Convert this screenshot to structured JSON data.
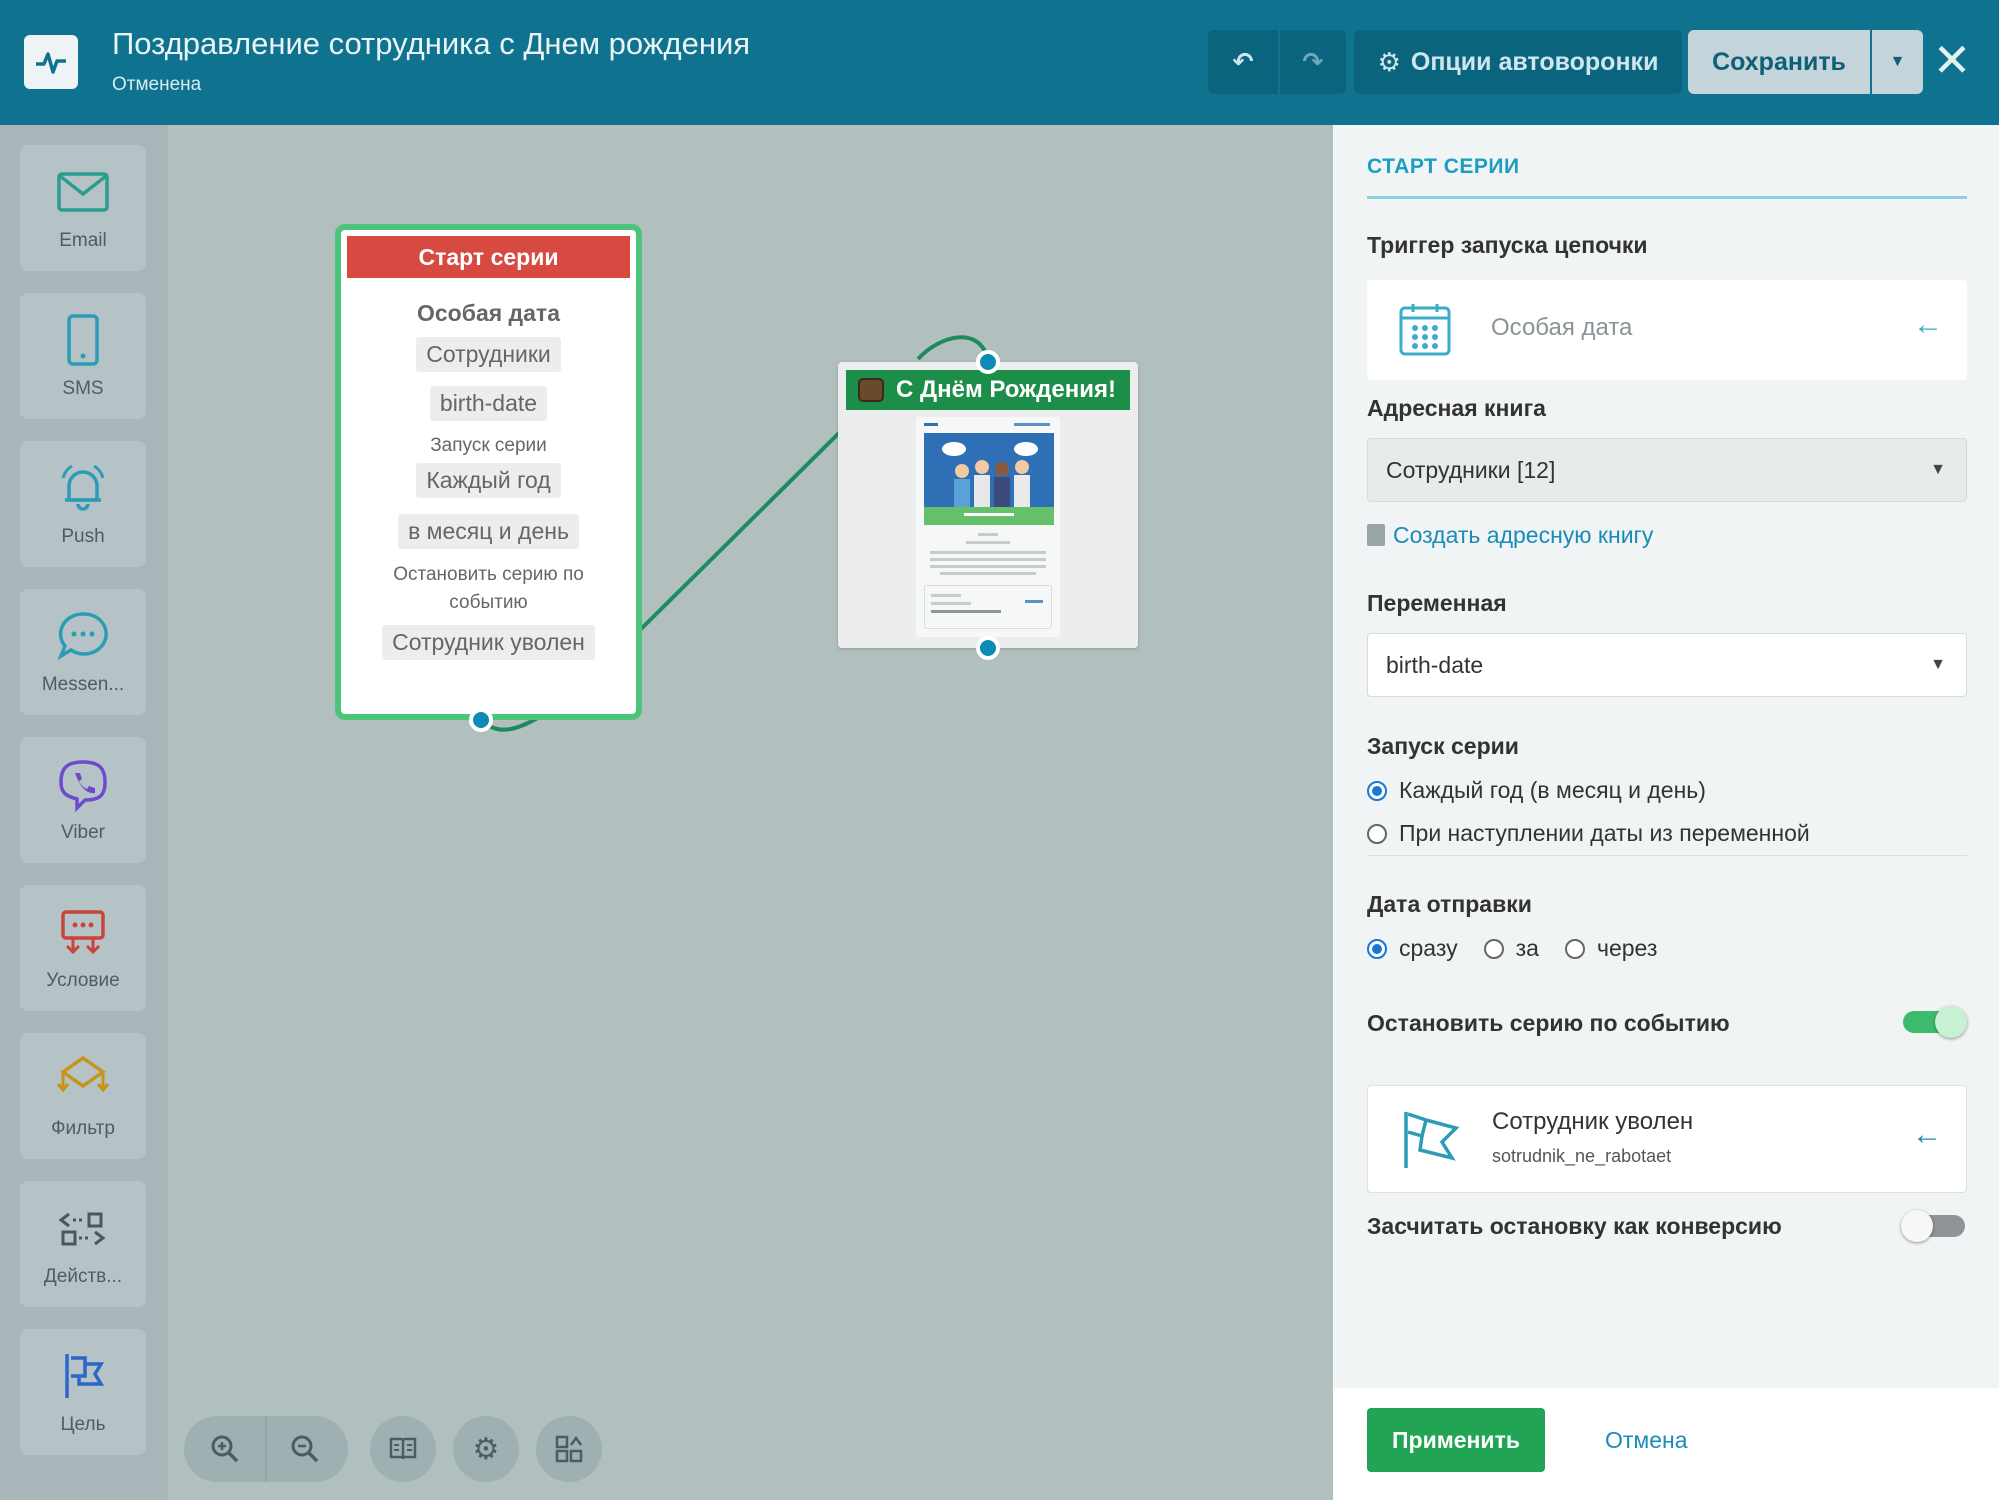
{
  "header": {
    "title": "Поздравление сотрудника с Днем рождения",
    "status": "Отменена",
    "options_label": "Опции автоворонки",
    "save_label": "Сохранить"
  },
  "toolbar": {
    "items": [
      {
        "label": "Email",
        "icon": "envelope-icon",
        "color": "#2a9d8f"
      },
      {
        "label": "SMS",
        "icon": "phone-icon",
        "color": "#2a9db5"
      },
      {
        "label": "Push",
        "icon": "bell-icon",
        "color": "#2a9db5"
      },
      {
        "label": "Messen...",
        "icon": "chat-icon",
        "color": "#2a9db5"
      },
      {
        "label": "Viber",
        "icon": "viber-icon",
        "color": "#6d4bd0"
      },
      {
        "label": "Условие",
        "icon": "condition-icon",
        "color": "#c8443c"
      },
      {
        "label": "Фильтр",
        "icon": "filter-icon",
        "color": "#c79416"
      },
      {
        "label": "Действ...",
        "icon": "action-icon",
        "color": "#47595e"
      },
      {
        "label": "Цель",
        "icon": "flag-icon",
        "color": "#2c66c7"
      }
    ]
  },
  "start_node": {
    "header": "Старт серии",
    "type": "Особая дата",
    "book": "Сотрудники",
    "variable": "birth-date",
    "launch_label": "Запуск серии",
    "launch_value": "Каждый год",
    "launch_detail": "в месяц и день",
    "stop_label": "Остановить серию по событию",
    "stop_value": "Сотрудник уволен"
  },
  "email_node": {
    "title": "С Днём Рождения!"
  },
  "panel": {
    "section_title": "СТАРТ СЕРИИ",
    "trigger_label": "Триггер запуска цепочки",
    "trigger_value": "Особая дата",
    "book_label": "Адресная книга",
    "book_value": "Сотрудники [12]",
    "create_book_link": "Создать адресную книгу",
    "variable_label": "Переменная",
    "variable_value": "birth-date",
    "launch_label": "Запуск серии",
    "launch_option_1": "Каждый год (в месяц и день)",
    "launch_option_2": "При наступлении даты из переменной",
    "send_date_label": "Дата отправки",
    "send_option_1": "сразу",
    "send_option_2": "за",
    "send_option_3": "через",
    "stop_label": "Остановить серию по событию",
    "event_name": "Сотрудник уволен",
    "event_code": "sotrudnik_ne_rabotaet",
    "conversion_label": "Засчитать остановку как конверсию",
    "apply_label": "Применить",
    "cancel_label": "Отмена"
  },
  "colors": {
    "header_bg": "#0f7390",
    "accent": "#1d9ec1",
    "start_header": "#d64a42",
    "node_border": "#4cc57a",
    "apply": "#22a455"
  }
}
